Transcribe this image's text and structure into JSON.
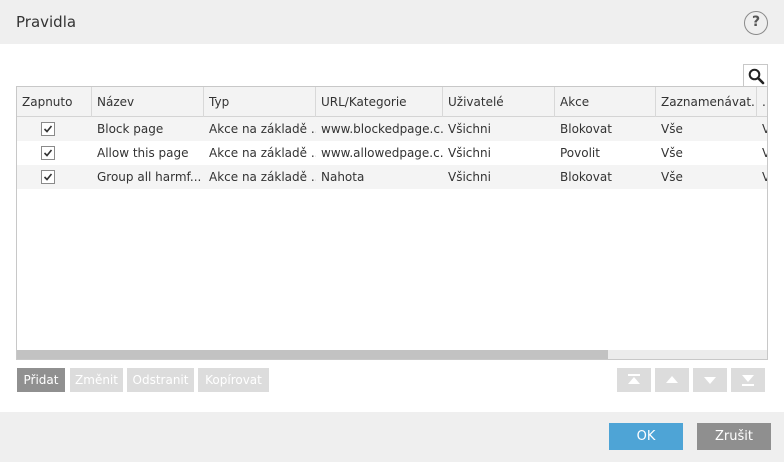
{
  "window": {
    "title": "Pravidla",
    "help_label": "?"
  },
  "search": {
    "icon": "search-icon"
  },
  "table": {
    "columns": [
      "Zapnuto",
      "Název",
      "Typ",
      "URL/Kategorie",
      "Uživatelé",
      "Akce",
      "Zaznamenávat...",
      "..."
    ],
    "rows": [
      {
        "enabled": true,
        "name": "Block page",
        "type": "Akce na základě ...",
        "url": "www.blockedpage.c...",
        "users": "Všichni",
        "action": "Blokovat",
        "log": "Vše",
        "extra": "V"
      },
      {
        "enabled": true,
        "name": "Allow this page",
        "type": "Akce na základě ...",
        "url": "www.allowedpage.c...",
        "users": "Všichni",
        "action": "Povolit",
        "log": "Vše",
        "extra": "V"
      },
      {
        "enabled": true,
        "name": "Group all harmf...",
        "type": "Akce na základě ...",
        "url": "Nahota",
        "users": "Všichni",
        "action": "Blokovat",
        "log": "Vše",
        "extra": "V"
      }
    ]
  },
  "actions": {
    "add": "Přidat",
    "edit": "Změnit",
    "remove": "Odstranit",
    "copy": "Kopírovat"
  },
  "move_buttons": [
    "move-top-icon",
    "move-up-icon",
    "move-down-icon",
    "move-bottom-icon"
  ],
  "footer": {
    "ok": "OK",
    "cancel": "Zrušit"
  },
  "colors": {
    "ok": "#4ea4d6",
    "cancel": "#8f8f8f",
    "active_button": "#909090",
    "disabled_button": "#dcdcdc"
  }
}
